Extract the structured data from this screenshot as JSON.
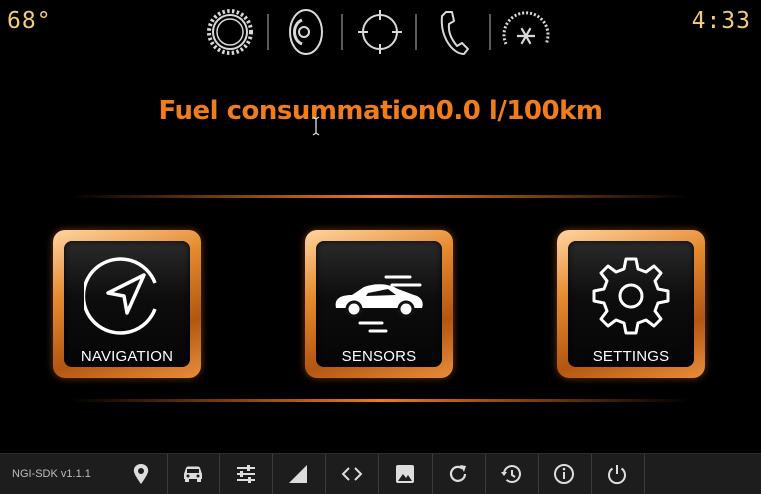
{
  "status": {
    "temperature": "68°",
    "clock": "4:33"
  },
  "top_icons": [
    "gear-icon",
    "speaker-icon",
    "crosshair-icon",
    "phone-icon",
    "climate-fan-icon"
  ],
  "fuel": {
    "label": "Fuel consummation",
    "value": "0.0 l/100km"
  },
  "tiles": [
    {
      "label": "NAVIGATION",
      "icon": "navigation-arrow-icon"
    },
    {
      "label": "SENSORS",
      "icon": "car-icon"
    },
    {
      "label": "SETTINGS",
      "icon": "gear-icon"
    }
  ],
  "bottom_bar": {
    "version": "NGI-SDK v1.1.1",
    "icons": [
      "location-pin-icon",
      "car-icon",
      "equalizer-icon",
      "signal-icon",
      "code-icon",
      "image-icon",
      "refresh-icon",
      "history-icon",
      "info-icon",
      "power-icon"
    ]
  },
  "colors": {
    "accent": "#ef7c1d",
    "status_text": "#f3cc78",
    "background": "#000000"
  }
}
